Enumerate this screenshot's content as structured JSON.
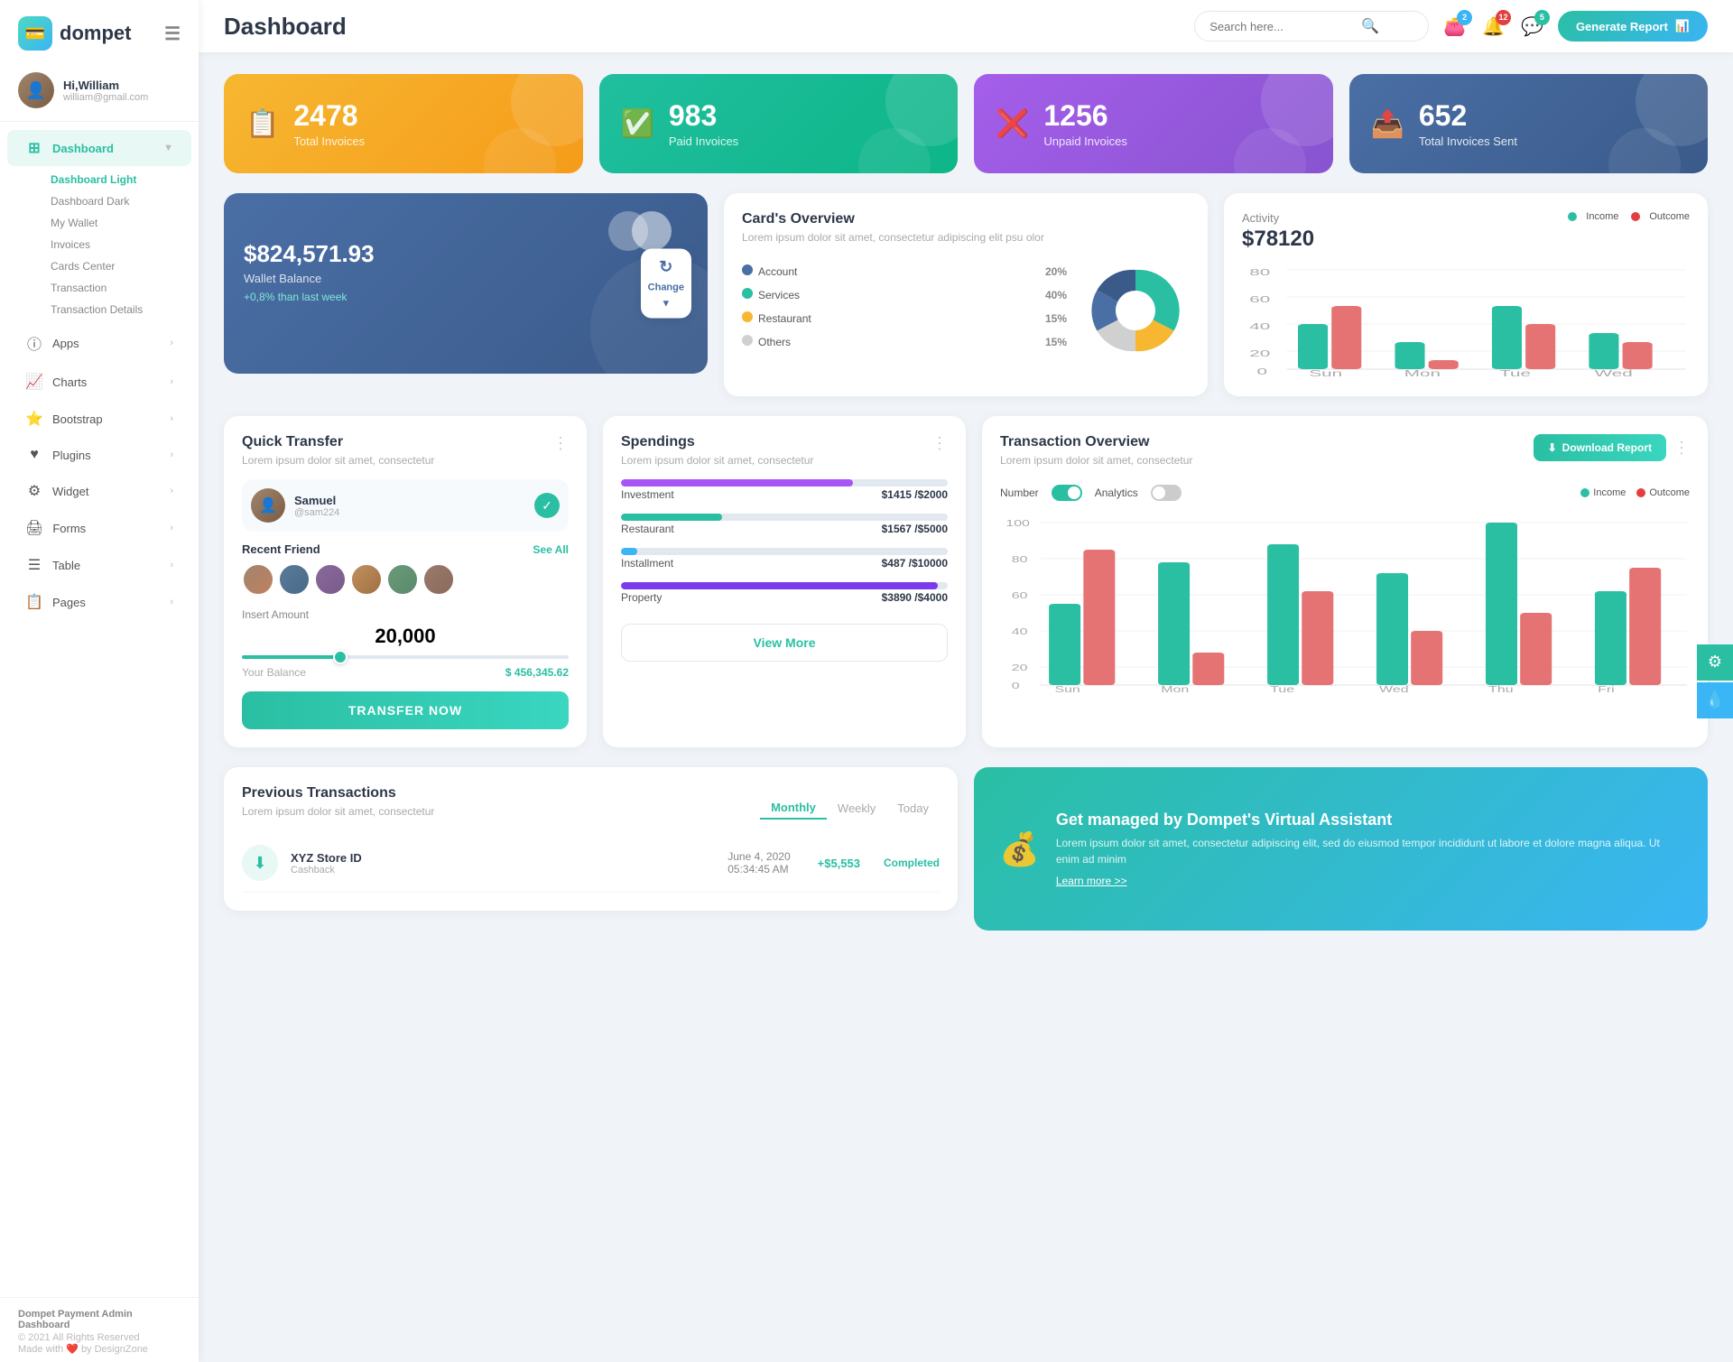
{
  "app": {
    "name": "dompet",
    "logo_icon": "💳"
  },
  "header": {
    "title": "Dashboard",
    "search_placeholder": "Search here...",
    "generate_btn": "Generate Report",
    "badges": {
      "wallet": "2",
      "bell": "12",
      "chat": "5"
    }
  },
  "user": {
    "greeting": "Hi,William",
    "email": "william@gmail.com",
    "avatar_emoji": "👤"
  },
  "sidebar": {
    "dashboard_label": "Dashboard",
    "sub_items": [
      {
        "label": "Dashboard Light",
        "active": true
      },
      {
        "label": "Dashboard Dark",
        "active": false
      },
      {
        "label": "My Wallet",
        "active": false
      },
      {
        "label": "Invoices",
        "active": false
      },
      {
        "label": "Cards Center",
        "active": false
      },
      {
        "label": "Transaction",
        "active": false
      },
      {
        "label": "Transaction Details",
        "active": false
      }
    ],
    "nav_items": [
      {
        "id": "apps",
        "label": "Apps",
        "icon": "ℹ️",
        "has_children": true
      },
      {
        "id": "charts",
        "label": "Charts",
        "icon": "📈",
        "has_children": true
      },
      {
        "id": "bootstrap",
        "label": "Bootstrap",
        "icon": "⭐",
        "has_children": true
      },
      {
        "id": "plugins",
        "label": "Plugins",
        "icon": "❤️",
        "has_children": true
      },
      {
        "id": "widget",
        "label": "Widget",
        "icon": "⚙️",
        "has_children": true
      },
      {
        "id": "forms",
        "label": "Forms",
        "icon": "🖨️",
        "has_children": true
      },
      {
        "id": "table",
        "label": "Table",
        "icon": "☰",
        "has_children": true
      },
      {
        "id": "pages",
        "label": "Pages",
        "icon": "📋",
        "has_children": true
      }
    ],
    "footer": {
      "brand": "Dompet Payment Admin Dashboard",
      "copyright": "© 2021 All Rights Reserved",
      "made_with": "Made with ❤️ by DesignZone"
    }
  },
  "stats": [
    {
      "id": "total-invoices",
      "number": "2478",
      "label": "Total Invoices",
      "color": "orange",
      "icon": "📋"
    },
    {
      "id": "paid-invoices",
      "number": "983",
      "label": "Paid Invoices",
      "color": "green",
      "icon": "✅"
    },
    {
      "id": "unpaid-invoices",
      "number": "1256",
      "label": "Unpaid Invoices",
      "color": "purple",
      "icon": "❌"
    },
    {
      "id": "total-sent",
      "number": "652",
      "label": "Total Invoices Sent",
      "color": "blue-dark",
      "icon": "📤"
    }
  ],
  "wallet": {
    "amount": "$824,571.93",
    "label": "Wallet Balance",
    "growth": "+0,8% than last week",
    "change_btn": "Change"
  },
  "cards_overview": {
    "title": "Card's Overview",
    "subtitle": "Lorem ipsum dolor sit amet, consectetur adipiscing elit psu olor",
    "items": [
      {
        "label": "Account",
        "pct": "20%",
        "color": "#4a6fa5"
      },
      {
        "label": "Services",
        "pct": "40%",
        "color": "#2abfa3"
      },
      {
        "label": "Restaurant",
        "pct": "15%",
        "color": "#f7b731"
      },
      {
        "label": "Others",
        "pct": "15%",
        "color": "#d0d0d0"
      }
    ]
  },
  "activity": {
    "title": "Activity",
    "amount": "$78120",
    "legend": [
      {
        "label": "Income",
        "color": "#2abfa3"
      },
      {
        "label": "Outcome",
        "color": "#e53e3e"
      }
    ],
    "days": [
      "Sun",
      "Mon",
      "Tue",
      "Wed"
    ],
    "income_bars": [
      40,
      20,
      60,
      30
    ],
    "outcome_bars": [
      60,
      10,
      40,
      20
    ]
  },
  "quick_transfer": {
    "title": "Quick Transfer",
    "subtitle": "Lorem ipsum dolor sit amet, consectetur",
    "contact": {
      "name": "Samuel",
      "handle": "@sam224"
    },
    "recent_friends_label": "Recent Friend",
    "see_all": "See All",
    "amount_label": "Insert Amount",
    "amount_value": "20,000",
    "balance_label": "Your Balance",
    "balance_value": "$ 456,345.62",
    "transfer_btn": "TRANSFER NOW"
  },
  "spendings": {
    "title": "Spendings",
    "subtitle": "Lorem ipsum dolor sit amet, consectetur",
    "items": [
      {
        "label": "Investment",
        "amount": "$1415",
        "total": "$2000",
        "pct": 71,
        "color": "#a855f7"
      },
      {
        "label": "Restaurant",
        "amount": "$1567",
        "total": "$5000",
        "pct": 31,
        "color": "#2abfa3"
      },
      {
        "label": "Installment",
        "amount": "$487",
        "total": "$10000",
        "pct": 5,
        "color": "#3ab5f5"
      },
      {
        "label": "Property",
        "amount": "$3890",
        "total": "$4000",
        "pct": 97,
        "color": "#7c3aed"
      }
    ],
    "view_more_btn": "View More"
  },
  "transaction_overview": {
    "title": "Transaction Overview",
    "subtitle": "Lorem ipsum dolor sit amet, consectetur",
    "download_btn": "Download Report",
    "toggle_labels": [
      "Number",
      "Analytics"
    ],
    "legend": [
      {
        "label": "Income",
        "color": "#2abfa3"
      },
      {
        "label": "Outcome",
        "color": "#e53e3e"
      }
    ],
    "days": [
      "Sun",
      "Mon",
      "Tue",
      "Wed",
      "Thu",
      "Fri"
    ],
    "income_bars": [
      45,
      68,
      78,
      62,
      90,
      52
    ],
    "outcome_bars": [
      75,
      18,
      52,
      30,
      40,
      65
    ],
    "y_labels": [
      "100",
      "80",
      "60",
      "40",
      "20",
      "0"
    ]
  },
  "previous_transactions": {
    "title": "Previous Transactions",
    "subtitle": "Lorem ipsum dolor sit amet, consectetur",
    "tabs": [
      "Monthly",
      "Weekly",
      "Today"
    ],
    "active_tab": "Monthly",
    "items": [
      {
        "name": "XYZ Store ID",
        "type": "Cashback",
        "date": "June 4, 2020",
        "time": "05:34:45 AM",
        "amount": "+$5,553",
        "status": "Completed"
      }
    ]
  },
  "virtual_assistant": {
    "title": "Get managed by Dompet's Virtual Assistant",
    "desc": "Lorem ipsum dolor sit amet, consectetur adipiscing elit, sed do eiusmod tempor incididunt ut labore et dolore magna aliqua. Ut enim ad minim",
    "link": "Learn more >>"
  }
}
